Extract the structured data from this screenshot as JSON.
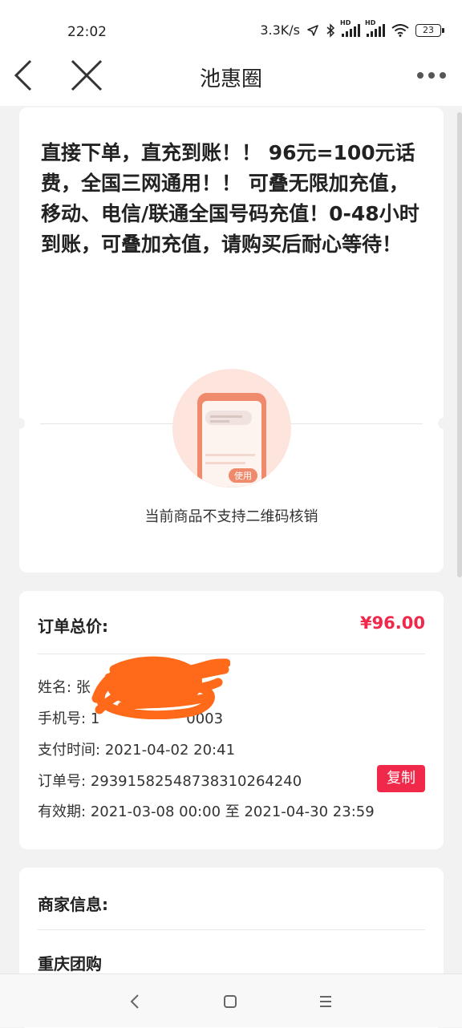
{
  "status_bar": {
    "time": "22:02",
    "speed": "3.3K/s",
    "battery": "23",
    "sig_label_1": "HD",
    "sig_label_2": "HD",
    "icons": [
      "location-icon",
      "bluetooth-icon",
      "signal-icon",
      "signal-icon",
      "wifi-icon",
      "battery-icon"
    ]
  },
  "nav": {
    "title": "池惠圈",
    "back_icon": "chevron-left-icon",
    "close_icon": "close-icon",
    "more_icon": "more-dots-icon"
  },
  "product": {
    "title": "直接下单，直充到账！！ 96元=100元话费，全国三网通用！！ 可叠无限加充值，移动、电信/联通全国号码充值！0-48小时到账，可叠加充值，请购买后耐心等待！",
    "qr_badge": "使用",
    "qr_message": "当前商品不支持二维码核销"
  },
  "order": {
    "total_label": "订单总价:",
    "total_price": "¥96.00",
    "name_label": "姓名:",
    "name_value": "张",
    "phone_label": "手机号:",
    "phone_value": "1",
    "phone_value_tail": "0003",
    "pay_time_label": "支付时间:",
    "pay_time_value": "2021-04-02 20:41",
    "order_no_label": "订单号:",
    "order_no_value": "29391582548738310264240",
    "copy_label": "复制",
    "validity_label": "有效期:",
    "validity_value": "2021-03-08 00:00 至 2021-04-30 23:59"
  },
  "merchant": {
    "section_label": "商家信息:",
    "name": "重庆团购"
  },
  "colors": {
    "accent": "#f0284a",
    "illustration": "#f08060",
    "page_bg": "#f2f2f2"
  }
}
